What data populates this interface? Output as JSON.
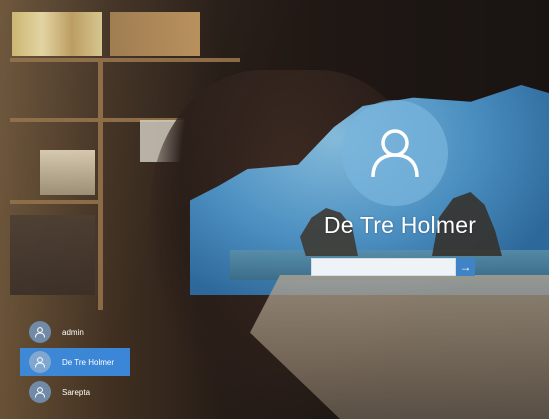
{
  "login": {
    "current_user": "De Tre Holmer",
    "password_placeholder": "",
    "submit_glyph": "→"
  },
  "users": [
    {
      "name": "admin",
      "selected": false
    },
    {
      "name": "De Tre Holmer",
      "selected": true
    },
    {
      "name": "Sarepta",
      "selected": false
    }
  ],
  "icons": {
    "large_avatar": "user-icon",
    "small_avatar": "user-icon",
    "submit": "arrow-right-icon"
  },
  "colors": {
    "selected_user": "#3b86d6",
    "submit_button": "#3f84c6",
    "avatar_circle": "#78b4dc"
  }
}
